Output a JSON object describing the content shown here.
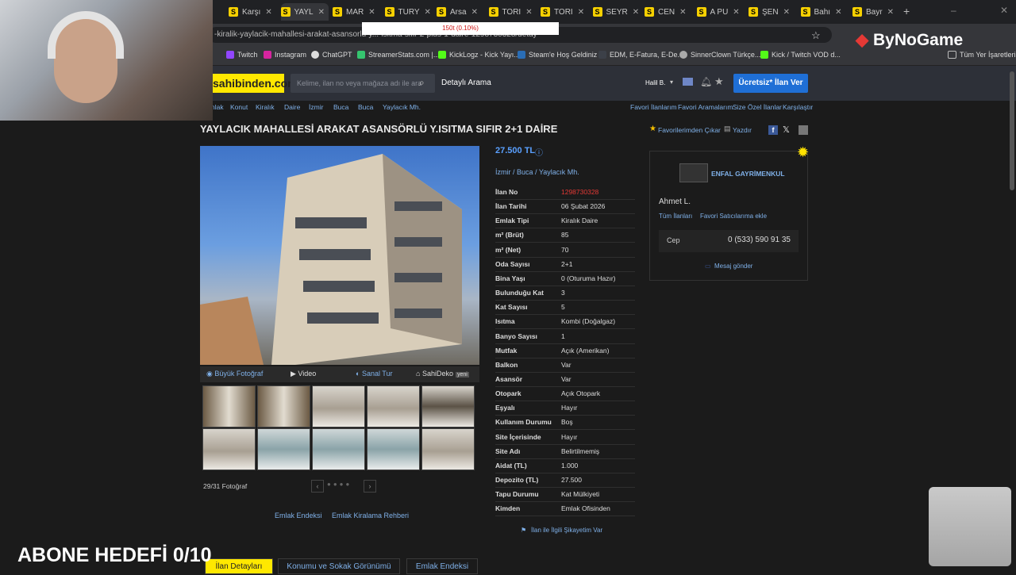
{
  "browser": {
    "tabs": [
      "Karşı",
      "YAYL",
      "MAR",
      "TURY",
      "Arsa",
      "TORI",
      "TORI",
      "SEYR",
      "CEN",
      "A PU",
      "ŞEN",
      "Bahı",
      "Bayr"
    ],
    "url": "-kiralik-yaylacik-mahallesi-arakat-asansorlu-y...-isitma-sifir-2-plus-1-daire-1298730328/detay",
    "bookmarks": [
      "Twitch",
      "Instagram",
      "ChatGPT",
      "StreamerStats.com |...",
      "KickLogz - Kick Yayı...",
      "Steam'e Hoş Geldiniz",
      "EDM, E-Fatura, E-De...",
      "SinnerClown Türkçe...",
      "Kick / Twitch VOD d...",
      "Tüm Yer İşaretleri"
    ]
  },
  "overlay": {
    "goal_line": "150t (0.10%)",
    "abone": "ABONE HEDEFİ 0/10",
    "brand": "ByNoGame"
  },
  "site": {
    "logo": "sahibinden.com",
    "search_placeholder": "Kelime, ilan no veya mağaza adı ile ara",
    "detailed_search": "Detaylı Arama",
    "user": "Halil B.",
    "post_button": "Ücretsiz* İlan Ver"
  },
  "breadcrumb": [
    "Emlak",
    "Konut",
    "Kiralık",
    "Daire",
    "İzmir",
    "Buca",
    "Buca",
    "Yaylacık Mh."
  ],
  "top_links": [
    "Favori İlanlarım",
    "Favori Aramalarım",
    "Size Özel İlanlar",
    "Karşılaştır"
  ],
  "listing": {
    "title": "YAYLACIK MAHALLESİ ARAKAT ASANSÖRLÜ Y.ISITMA SIFIR 2+1 DAİRE",
    "fav_remove": "Favorilerimden Çıkar",
    "print": "Yazdır",
    "price": "27.500 TL",
    "location": [
      "İzmir",
      "Buca",
      "Yaylacık Mh."
    ],
    "photo_tabs": [
      "Büyük Fotoğraf",
      "Video",
      "Sanal Tur",
      "SahiDeko"
    ],
    "photo_new": "yeni",
    "photo_count": "29/31 Fotoğraf",
    "links": [
      "Emlak Endeksi",
      "Emlak Kiralama Rehberi"
    ],
    "complaint": "İlan ile İlgili Şikayetim Var",
    "details": [
      {
        "k": "İlan No",
        "v": "1298730328"
      },
      {
        "k": "İlan Tarihi",
        "v": "06 Şubat 2026"
      },
      {
        "k": "Emlak Tipi",
        "v": "Kiralık Daire"
      },
      {
        "k": "m² (Brüt)",
        "v": "85"
      },
      {
        "k": "m² (Net)",
        "v": "70"
      },
      {
        "k": "Oda Sayısı",
        "v": "2+1"
      },
      {
        "k": "Bina Yaşı",
        "v": "0 (Oturuma Hazır)"
      },
      {
        "k": "Bulunduğu Kat",
        "v": "3"
      },
      {
        "k": "Kat Sayısı",
        "v": "5"
      },
      {
        "k": "Isıtma",
        "v": "Kombi (Doğalgaz)"
      },
      {
        "k": "Banyo Sayısı",
        "v": "1"
      },
      {
        "k": "Mutfak",
        "v": "Açık (Amerikan)"
      },
      {
        "k": "Balkon",
        "v": "Var"
      },
      {
        "k": "Asansör",
        "v": "Var"
      },
      {
        "k": "Otopark",
        "v": "Açık Otopark"
      },
      {
        "k": "Eşyalı",
        "v": "Hayır"
      },
      {
        "k": "Kullanım Durumu",
        "v": "Boş"
      },
      {
        "k": "Site İçerisinde",
        "v": "Hayır"
      },
      {
        "k": "Site Adı",
        "v": "Belirtilmemiş"
      },
      {
        "k": "Aidat (TL)",
        "v": "1.000"
      },
      {
        "k": "Depozito (TL)",
        "v": "27.500"
      },
      {
        "k": "Tapu Durumu",
        "v": "Kat Mülkiyeti"
      },
      {
        "k": "Kimden",
        "v": "Emlak Ofisinden"
      }
    ]
  },
  "seller": {
    "office": "ENFAL GAYRİMENKUL",
    "name": "Ahmet L.",
    "all_listings": "Tüm İlanları",
    "fav_sellers": "Favori Satıcılarıma ekle",
    "phone_label": "Cep",
    "phone": "0 (533) 590 91 35",
    "message": "Mesaj gönder"
  },
  "bottom_tabs": [
    "İlan Detayları",
    "Konumu ve Sokak Görünümü",
    "Emlak Endeksi"
  ]
}
